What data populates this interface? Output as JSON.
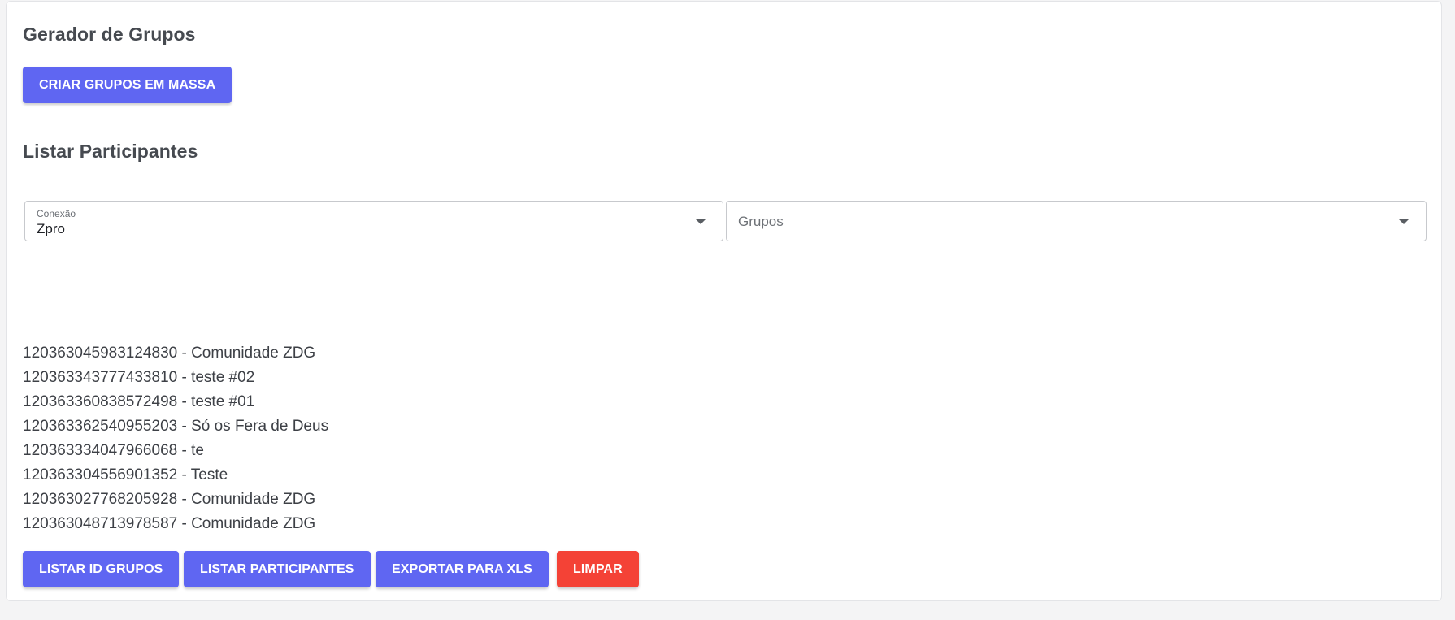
{
  "generator": {
    "title": "Gerador de Grupos",
    "create_button": "CRIAR GRUPOS EM MASSA"
  },
  "participants": {
    "title": "Listar Participantes",
    "connection": {
      "label": "Conexão",
      "value": "Zpro"
    },
    "groups_select": {
      "placeholder": "Grupos"
    },
    "groups": [
      "120363045983124830 - Comunidade ZDG",
      "120363343777433810 - teste #02",
      "120363360838572498 - teste #01",
      "120363362540955203 - Só os Fera de Deus",
      "120363334047966068 - te",
      "120363304556901352 - Teste",
      "120363027768205928 - Comunidade ZDG",
      "120363048713978587 - Comunidade ZDG"
    ],
    "actions": {
      "list_ids": "LISTAR ID GRUPOS",
      "list_participants": "LISTAR PARTICIPANTES",
      "export_xls": "EXPORTAR PARA XLS",
      "clear": "LIMPAR"
    }
  },
  "colors": {
    "primary": "#5f66f2",
    "danger": "#f44236",
    "background": "#f4f4f5",
    "card": "#ffffff"
  }
}
